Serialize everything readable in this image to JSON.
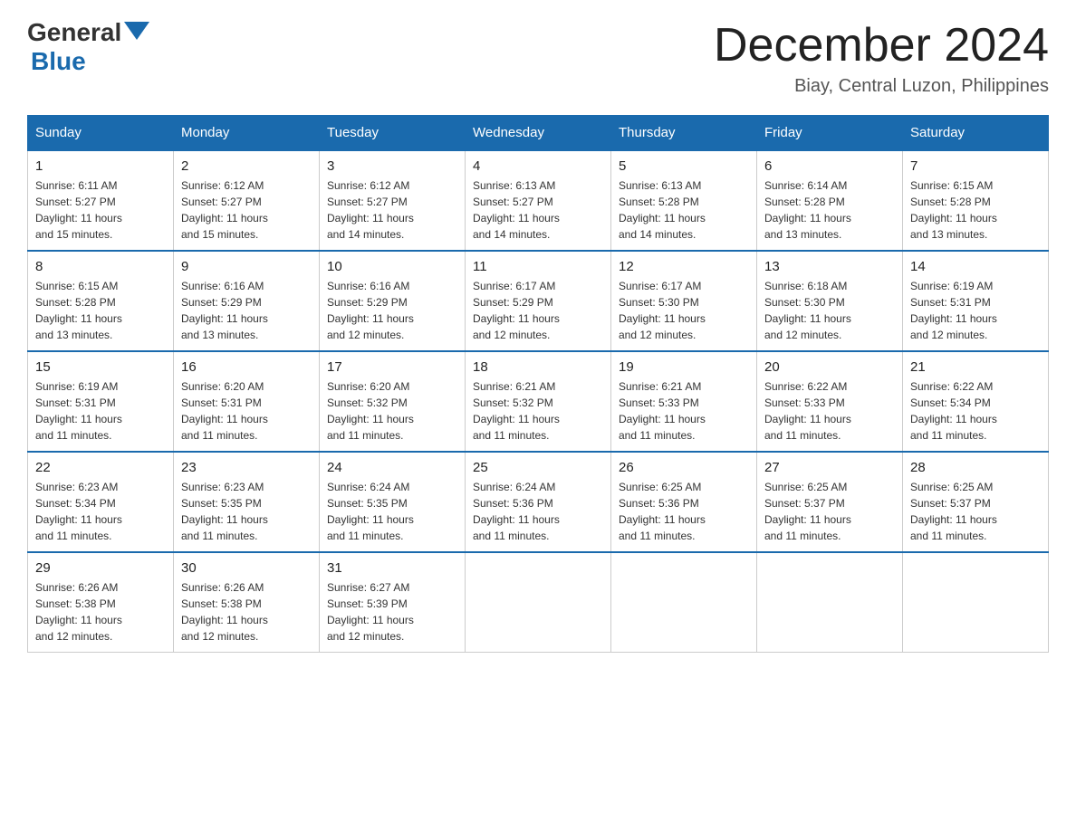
{
  "header": {
    "logo_general": "General",
    "logo_blue": "Blue",
    "month_title": "December 2024",
    "subtitle": "Biay, Central Luzon, Philippines"
  },
  "days_of_week": [
    "Sunday",
    "Monday",
    "Tuesday",
    "Wednesday",
    "Thursday",
    "Friday",
    "Saturday"
  ],
  "weeks": [
    [
      {
        "day": "1",
        "sunrise": "6:11 AM",
        "sunset": "5:27 PM",
        "daylight": "11 hours and 15 minutes."
      },
      {
        "day": "2",
        "sunrise": "6:12 AM",
        "sunset": "5:27 PM",
        "daylight": "11 hours and 15 minutes."
      },
      {
        "day": "3",
        "sunrise": "6:12 AM",
        "sunset": "5:27 PM",
        "daylight": "11 hours and 14 minutes."
      },
      {
        "day": "4",
        "sunrise": "6:13 AM",
        "sunset": "5:27 PM",
        "daylight": "11 hours and 14 minutes."
      },
      {
        "day": "5",
        "sunrise": "6:13 AM",
        "sunset": "5:28 PM",
        "daylight": "11 hours and 14 minutes."
      },
      {
        "day": "6",
        "sunrise": "6:14 AM",
        "sunset": "5:28 PM",
        "daylight": "11 hours and 13 minutes."
      },
      {
        "day": "7",
        "sunrise": "6:15 AM",
        "sunset": "5:28 PM",
        "daylight": "11 hours and 13 minutes."
      }
    ],
    [
      {
        "day": "8",
        "sunrise": "6:15 AM",
        "sunset": "5:28 PM",
        "daylight": "11 hours and 13 minutes."
      },
      {
        "day": "9",
        "sunrise": "6:16 AM",
        "sunset": "5:29 PM",
        "daylight": "11 hours and 13 minutes."
      },
      {
        "day": "10",
        "sunrise": "6:16 AM",
        "sunset": "5:29 PM",
        "daylight": "11 hours and 12 minutes."
      },
      {
        "day": "11",
        "sunrise": "6:17 AM",
        "sunset": "5:29 PM",
        "daylight": "11 hours and 12 minutes."
      },
      {
        "day": "12",
        "sunrise": "6:17 AM",
        "sunset": "5:30 PM",
        "daylight": "11 hours and 12 minutes."
      },
      {
        "day": "13",
        "sunrise": "6:18 AM",
        "sunset": "5:30 PM",
        "daylight": "11 hours and 12 minutes."
      },
      {
        "day": "14",
        "sunrise": "6:19 AM",
        "sunset": "5:31 PM",
        "daylight": "11 hours and 12 minutes."
      }
    ],
    [
      {
        "day": "15",
        "sunrise": "6:19 AM",
        "sunset": "5:31 PM",
        "daylight": "11 hours and 11 minutes."
      },
      {
        "day": "16",
        "sunrise": "6:20 AM",
        "sunset": "5:31 PM",
        "daylight": "11 hours and 11 minutes."
      },
      {
        "day": "17",
        "sunrise": "6:20 AM",
        "sunset": "5:32 PM",
        "daylight": "11 hours and 11 minutes."
      },
      {
        "day": "18",
        "sunrise": "6:21 AM",
        "sunset": "5:32 PM",
        "daylight": "11 hours and 11 minutes."
      },
      {
        "day": "19",
        "sunrise": "6:21 AM",
        "sunset": "5:33 PM",
        "daylight": "11 hours and 11 minutes."
      },
      {
        "day": "20",
        "sunrise": "6:22 AM",
        "sunset": "5:33 PM",
        "daylight": "11 hours and 11 minutes."
      },
      {
        "day": "21",
        "sunrise": "6:22 AM",
        "sunset": "5:34 PM",
        "daylight": "11 hours and 11 minutes."
      }
    ],
    [
      {
        "day": "22",
        "sunrise": "6:23 AM",
        "sunset": "5:34 PM",
        "daylight": "11 hours and 11 minutes."
      },
      {
        "day": "23",
        "sunrise": "6:23 AM",
        "sunset": "5:35 PM",
        "daylight": "11 hours and 11 minutes."
      },
      {
        "day": "24",
        "sunrise": "6:24 AM",
        "sunset": "5:35 PM",
        "daylight": "11 hours and 11 minutes."
      },
      {
        "day": "25",
        "sunrise": "6:24 AM",
        "sunset": "5:36 PM",
        "daylight": "11 hours and 11 minutes."
      },
      {
        "day": "26",
        "sunrise": "6:25 AM",
        "sunset": "5:36 PM",
        "daylight": "11 hours and 11 minutes."
      },
      {
        "day": "27",
        "sunrise": "6:25 AM",
        "sunset": "5:37 PM",
        "daylight": "11 hours and 11 minutes."
      },
      {
        "day": "28",
        "sunrise": "6:25 AM",
        "sunset": "5:37 PM",
        "daylight": "11 hours and 11 minutes."
      }
    ],
    [
      {
        "day": "29",
        "sunrise": "6:26 AM",
        "sunset": "5:38 PM",
        "daylight": "11 hours and 12 minutes."
      },
      {
        "day": "30",
        "sunrise": "6:26 AM",
        "sunset": "5:38 PM",
        "daylight": "11 hours and 12 minutes."
      },
      {
        "day": "31",
        "sunrise": "6:27 AM",
        "sunset": "5:39 PM",
        "daylight": "11 hours and 12 minutes."
      },
      null,
      null,
      null,
      null
    ]
  ],
  "labels": {
    "sunrise": "Sunrise:",
    "sunset": "Sunset:",
    "daylight": "Daylight:"
  }
}
